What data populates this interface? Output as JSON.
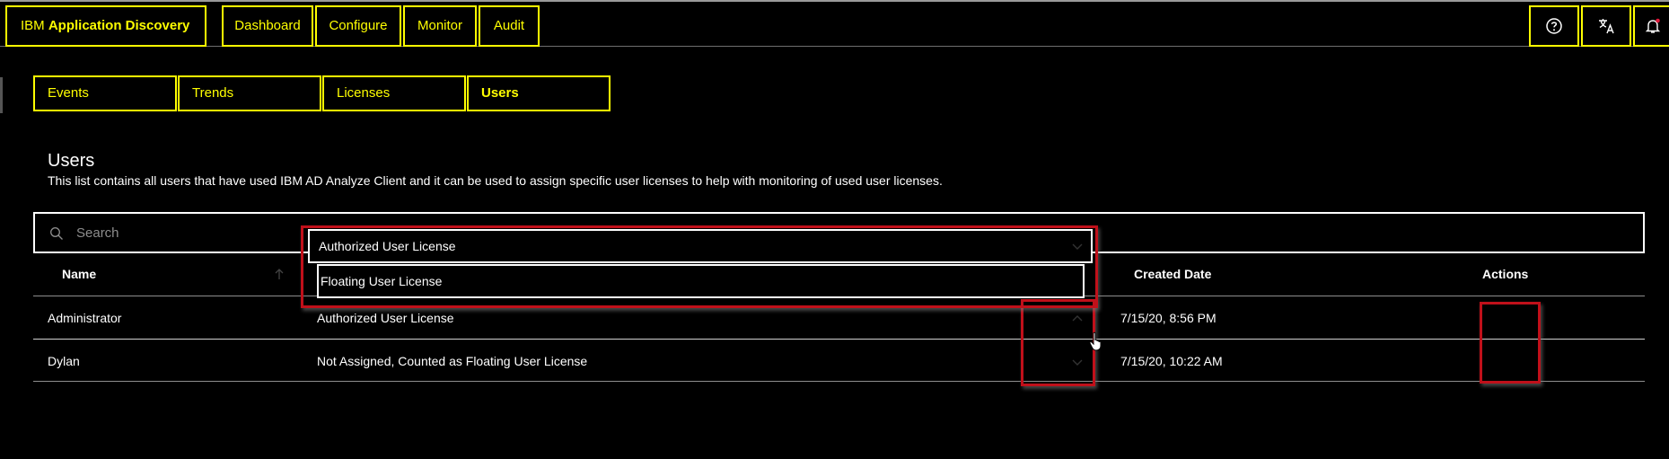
{
  "header": {
    "brand_prefix": "IBM ",
    "brand_name": "Application Discovery",
    "nav": [
      {
        "label": "Dashboard"
      },
      {
        "label": "Configure"
      },
      {
        "label": "Monitor"
      },
      {
        "label": "Audit"
      }
    ],
    "icons": [
      "help-icon",
      "translate-icon",
      "notification-icon"
    ]
  },
  "tabs": [
    {
      "label": "Events"
    },
    {
      "label": "Trends"
    },
    {
      "label": "Licenses"
    },
    {
      "label": "Users",
      "active": true
    }
  ],
  "page": {
    "title": "Users",
    "description": "This list contains all users that have used IBM AD Analyze Client and it can be used to assign specific user licenses to help with monitoring of used user licenses."
  },
  "search": {
    "placeholder": "Search"
  },
  "table": {
    "headers": {
      "name": "Name",
      "created": "Created Date",
      "actions": "Actions"
    },
    "rows": [
      {
        "name": "Administrator",
        "license": "Authorized User License",
        "created": "7/15/20, 8:56 PM"
      },
      {
        "name": "Dylan",
        "license": "Not Assigned, Counted as Floating User License",
        "created": "7/15/20, 10:22 AM"
      }
    ]
  },
  "dropdown": {
    "selected": "Authorized User License",
    "options": [
      "Floating User License"
    ]
  },
  "colors": {
    "accent": "#ffff00",
    "highlight": "#c0101a",
    "background": "#000000"
  }
}
